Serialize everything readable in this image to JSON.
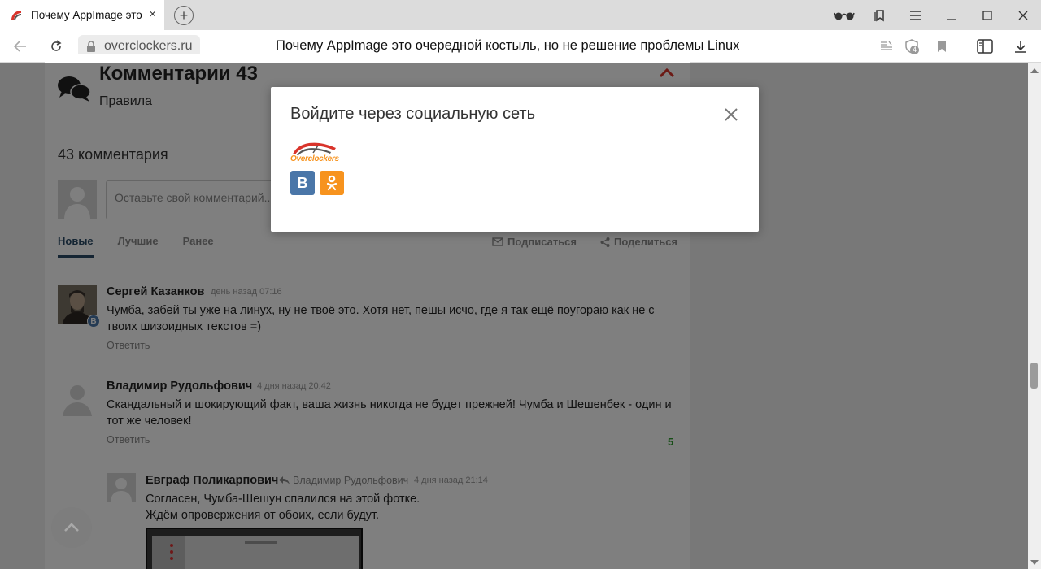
{
  "browser": {
    "tab_title": "Почему AppImage это очередной костыль, но не решение проблемы Linux",
    "tab_title_visible": "Почему AppImage это",
    "tab_close": "×",
    "new_tab": "+",
    "domain": "overclockers.ru",
    "page_title": "Почему AppImage это очередной костыль, но не решение проблемы Linux",
    "tracker_count": "4"
  },
  "comments": {
    "heading": "Комментарии 43",
    "rules_link": "Правила",
    "count_text": "43 комментария",
    "input_placeholder": "Оставьте свой комментарий...",
    "tabs": [
      {
        "label": "Новые",
        "active": true
      },
      {
        "label": "Лучшие",
        "active": false
      },
      {
        "label": "Ранее",
        "active": false
      }
    ],
    "subscribe": "Подписаться",
    "share": "Поделиться",
    "items": [
      {
        "author": "Сергей Казанков",
        "time": "день назад 07:16",
        "text": "Чумба, забей ты уже на линух, ну не твоё это. Хотя нет, пешы исчо, где я так ещё поугораю как не с твоих шизоидных текстов =)",
        "reply": "Ответить",
        "badge": "В"
      },
      {
        "author": "Владимир Рудольфович",
        "time": "4 дня назад 20:42",
        "text": "Скандальный и шокирующий факт, ваша жизнь никогда не будет прежней! Чумба и Шешенбек - один и тот же человек!",
        "reply": "Ответить",
        "rating": "5"
      },
      {
        "author": "Евграф Поликарпович",
        "reply_to": "Владимир Рудольфович",
        "time": "4 дня назад 21:14",
        "text_line1": "Согласен, Чумба-Шешун спалился на этой фотке.",
        "text_line2": "Ждём опровержения от обоих, если будут."
      }
    ]
  },
  "modal": {
    "title": "Войдите через социальную сеть",
    "logo_text": "Overclockers",
    "vk_label": "В",
    "ok_label": "OK"
  },
  "colors": {
    "vk": "#4a76a8",
    "ok": "#f7931e",
    "accent_red": "#d9342b",
    "vote_green": "#2e9c2e"
  }
}
